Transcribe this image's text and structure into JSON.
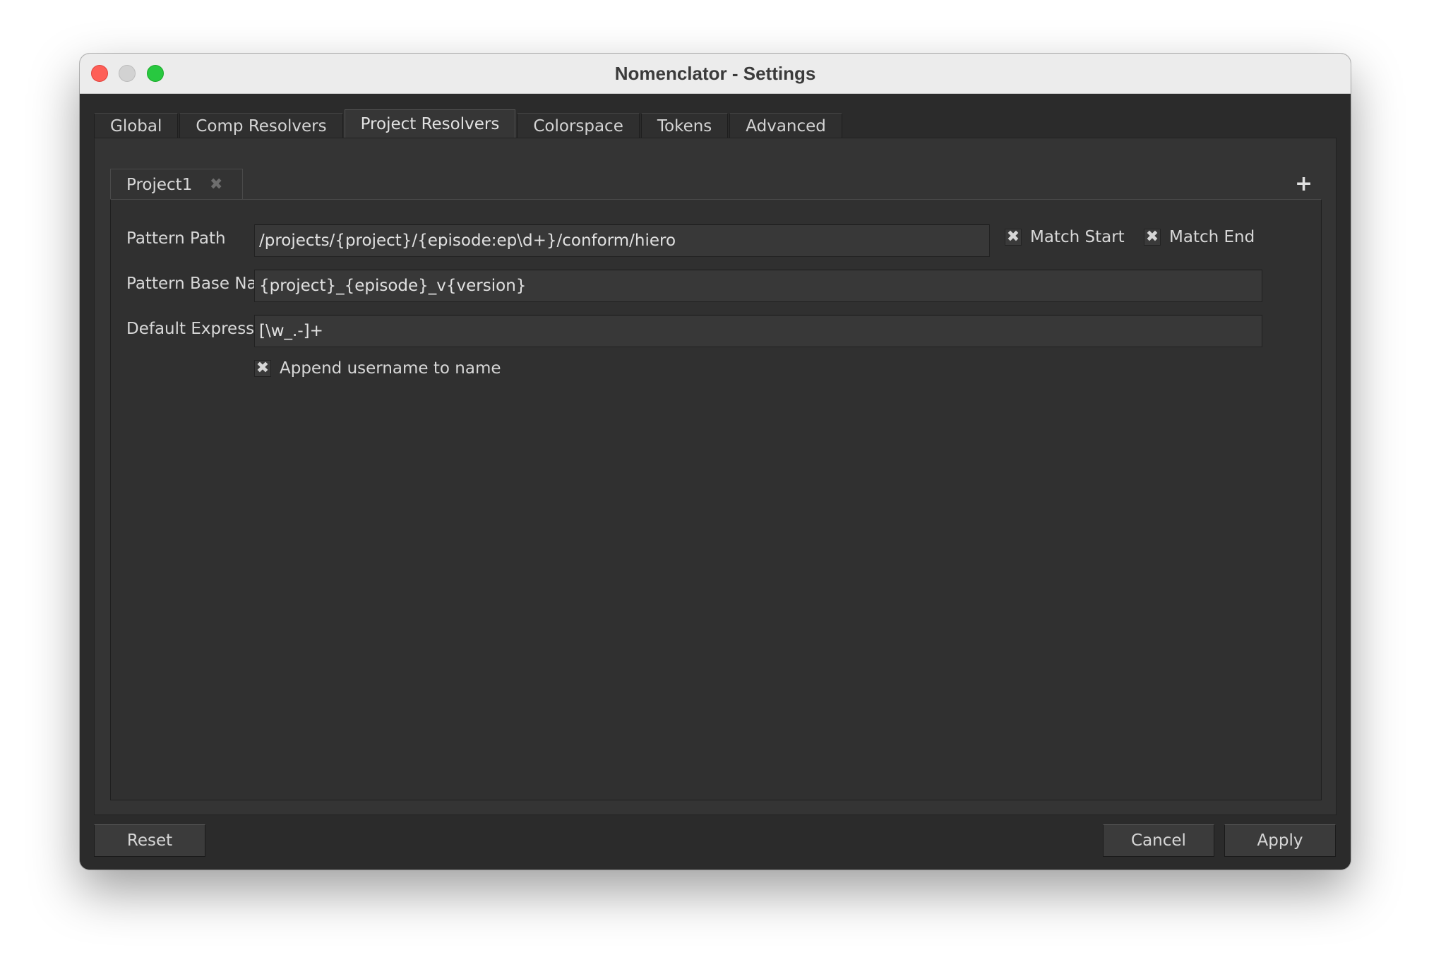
{
  "window": {
    "title": "Nomenclator - Settings"
  },
  "main_tabs": [
    {
      "label": "Global"
    },
    {
      "label": "Comp Resolvers"
    },
    {
      "label": "Project Resolvers",
      "active": true
    },
    {
      "label": "Colorspace"
    },
    {
      "label": "Tokens"
    },
    {
      "label": "Advanced"
    }
  ],
  "project_tabs": [
    {
      "label": "Project1",
      "close_icon": "close-icon"
    }
  ],
  "add_project_icon": "+",
  "form": {
    "pattern_path": {
      "label": "Pattern Path",
      "value": "/projects/{project}/{episode:ep\\d+}/conform/hiero"
    },
    "match_start": {
      "label": "Match Start",
      "checked": true
    },
    "match_end": {
      "label": "Match End",
      "checked": true
    },
    "pattern_base_name": {
      "label": "Pattern Base Name",
      "value": "{project}_{episode}_v{version}"
    },
    "default_expression": {
      "label": "Default Expression",
      "value": "[\\w_.-]+"
    },
    "append_username": {
      "label": "Append username to name",
      "checked": true
    }
  },
  "buttons": {
    "reset": "Reset",
    "cancel": "Cancel",
    "apply": "Apply"
  },
  "check_glyph": "✖",
  "colors": {
    "background": "#2b2b2b",
    "panel": "#343434",
    "field": "#383838",
    "text": "#d8d8d8",
    "close_button": "#fe5f57",
    "minimize_button": "#d2d2d2",
    "maximize_button": "#28c840"
  }
}
